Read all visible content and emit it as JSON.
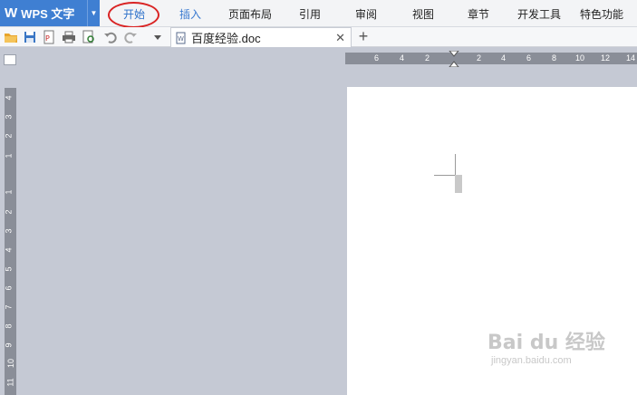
{
  "app": {
    "logo": "W",
    "title": "WPS 文字"
  },
  "menu": {
    "items": [
      {
        "label": "开始"
      },
      {
        "label": "插入"
      },
      {
        "label": "页面布局"
      },
      {
        "label": "引用"
      },
      {
        "label": "审阅"
      },
      {
        "label": "视图"
      },
      {
        "label": "章节"
      },
      {
        "label": "开发工具"
      },
      {
        "label": "特色功能"
      }
    ]
  },
  "tab": {
    "title": "百度经验.doc",
    "close_icon": "close-icon"
  },
  "new_tab_icon": "plus-icon",
  "hruler": {
    "ticks": [
      "6",
      "4",
      "2",
      "2",
      "4",
      "6",
      "8",
      "10",
      "12",
      "14"
    ]
  },
  "vruler": {
    "ticks": [
      "4",
      "3",
      "2",
      "1",
      "1",
      "2",
      "3",
      "4",
      "5",
      "6",
      "7",
      "8",
      "9",
      "10",
      "11"
    ]
  },
  "watermark": {
    "main": "Bai du 经验",
    "sub": "jingyan.baidu.com"
  },
  "colors": {
    "accent": "#3f7fd2",
    "highlight": "#d92424",
    "workspace": "#c5c9d4"
  }
}
